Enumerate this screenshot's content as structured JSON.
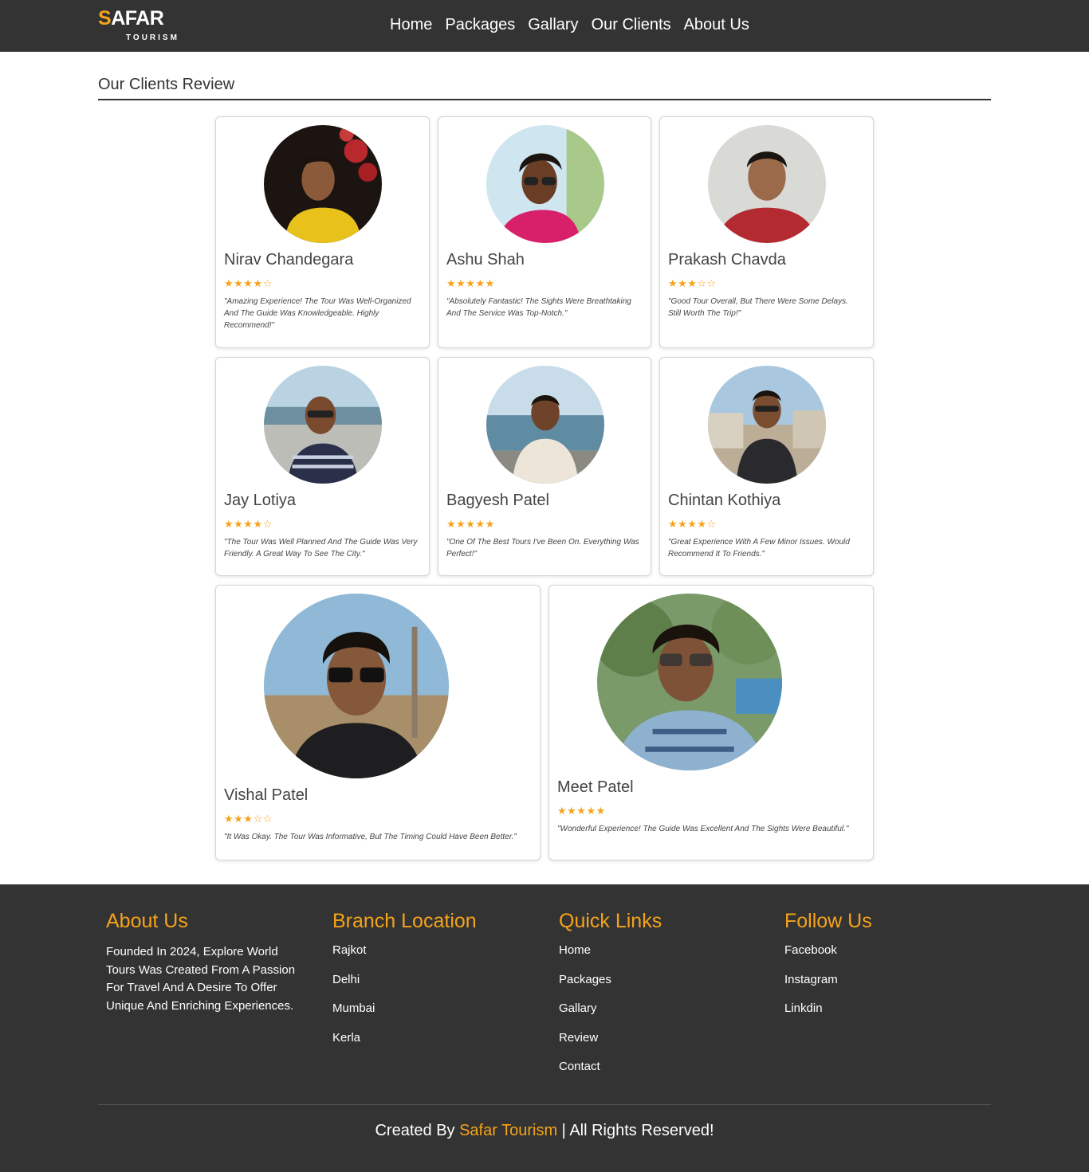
{
  "brand": {
    "first_letter": "S",
    "rest": "AFAR",
    "tagline": "TOURISM"
  },
  "nav": [
    "Home",
    "Packages",
    "Gallary",
    "Our Clients",
    "About Us"
  ],
  "section_title": "Our Clients Review",
  "reviews": [
    {
      "name": "Nirav Chandegara",
      "stars": "★★★★☆",
      "rating": 4,
      "text": "\"Amazing Experience! The Tour Was Well-Organized And The Guide Was Knowledgeable. Highly Recommend!\""
    },
    {
      "name": "Ashu Shah",
      "stars": "★★★★★",
      "rating": 5,
      "text": "\"Absolutely Fantastic! The Sights Were Breathtaking And The Service Was Top-Notch.\""
    },
    {
      "name": "Prakash Chavda",
      "stars": "★★★☆☆",
      "rating": 3,
      "text": "\"Good Tour Overall, But There Were Some Delays. Still Worth The Trip!\""
    },
    {
      "name": "Jay Lotiya",
      "stars": "★★★★☆",
      "rating": 4,
      "text": "\"The Tour Was Well Planned And The Guide Was Very Friendly. A Great Way To See The City.\""
    },
    {
      "name": "Bagyesh Patel",
      "stars": "★★★★★",
      "rating": 5,
      "text": "\"One Of The Best Tours I've Been On. Everything Was Perfect!\""
    },
    {
      "name": "Chintan Kothiya",
      "stars": "★★★★☆",
      "rating": 4,
      "text": "\"Great Experience With A Few Minor Issues. Would Recommend It To Friends.\""
    },
    {
      "name": "Vishal Patel",
      "stars": "★★★☆☆",
      "rating": 3,
      "text": "\"It Was Okay. The Tour Was Informative, But The Timing Could Have Been Better.\""
    },
    {
      "name": "Meet Patel",
      "stars": "★★★★★",
      "rating": 5,
      "text": "\"Wonderful Experience! The Guide Was Excellent And The Sights Were Beautiful.\""
    }
  ],
  "footer": {
    "about": {
      "title": "About Us",
      "text": "Founded In 2024, Explore World Tours Was Created From A Passion For Travel And A Desire To Offer Unique And Enriching Experiences."
    },
    "branches": {
      "title": "Branch Location",
      "items": [
        "Rajkot",
        "Delhi",
        "Mumbai",
        "Kerla"
      ]
    },
    "quick_links": {
      "title": "Quick Links",
      "items": [
        "Home",
        "Packages",
        "Gallary",
        "Review",
        "Contact"
      ]
    },
    "follow": {
      "title": "Follow Us",
      "items": [
        "Facebook",
        "Instagram",
        "Linkdin"
      ]
    },
    "copyright": {
      "prefix": "Created By ",
      "brand": "Safar Tourism",
      "suffix": " | All Rights Reserved!"
    }
  },
  "colors": {
    "accent": "#f5a31a",
    "dark": "#333333"
  }
}
